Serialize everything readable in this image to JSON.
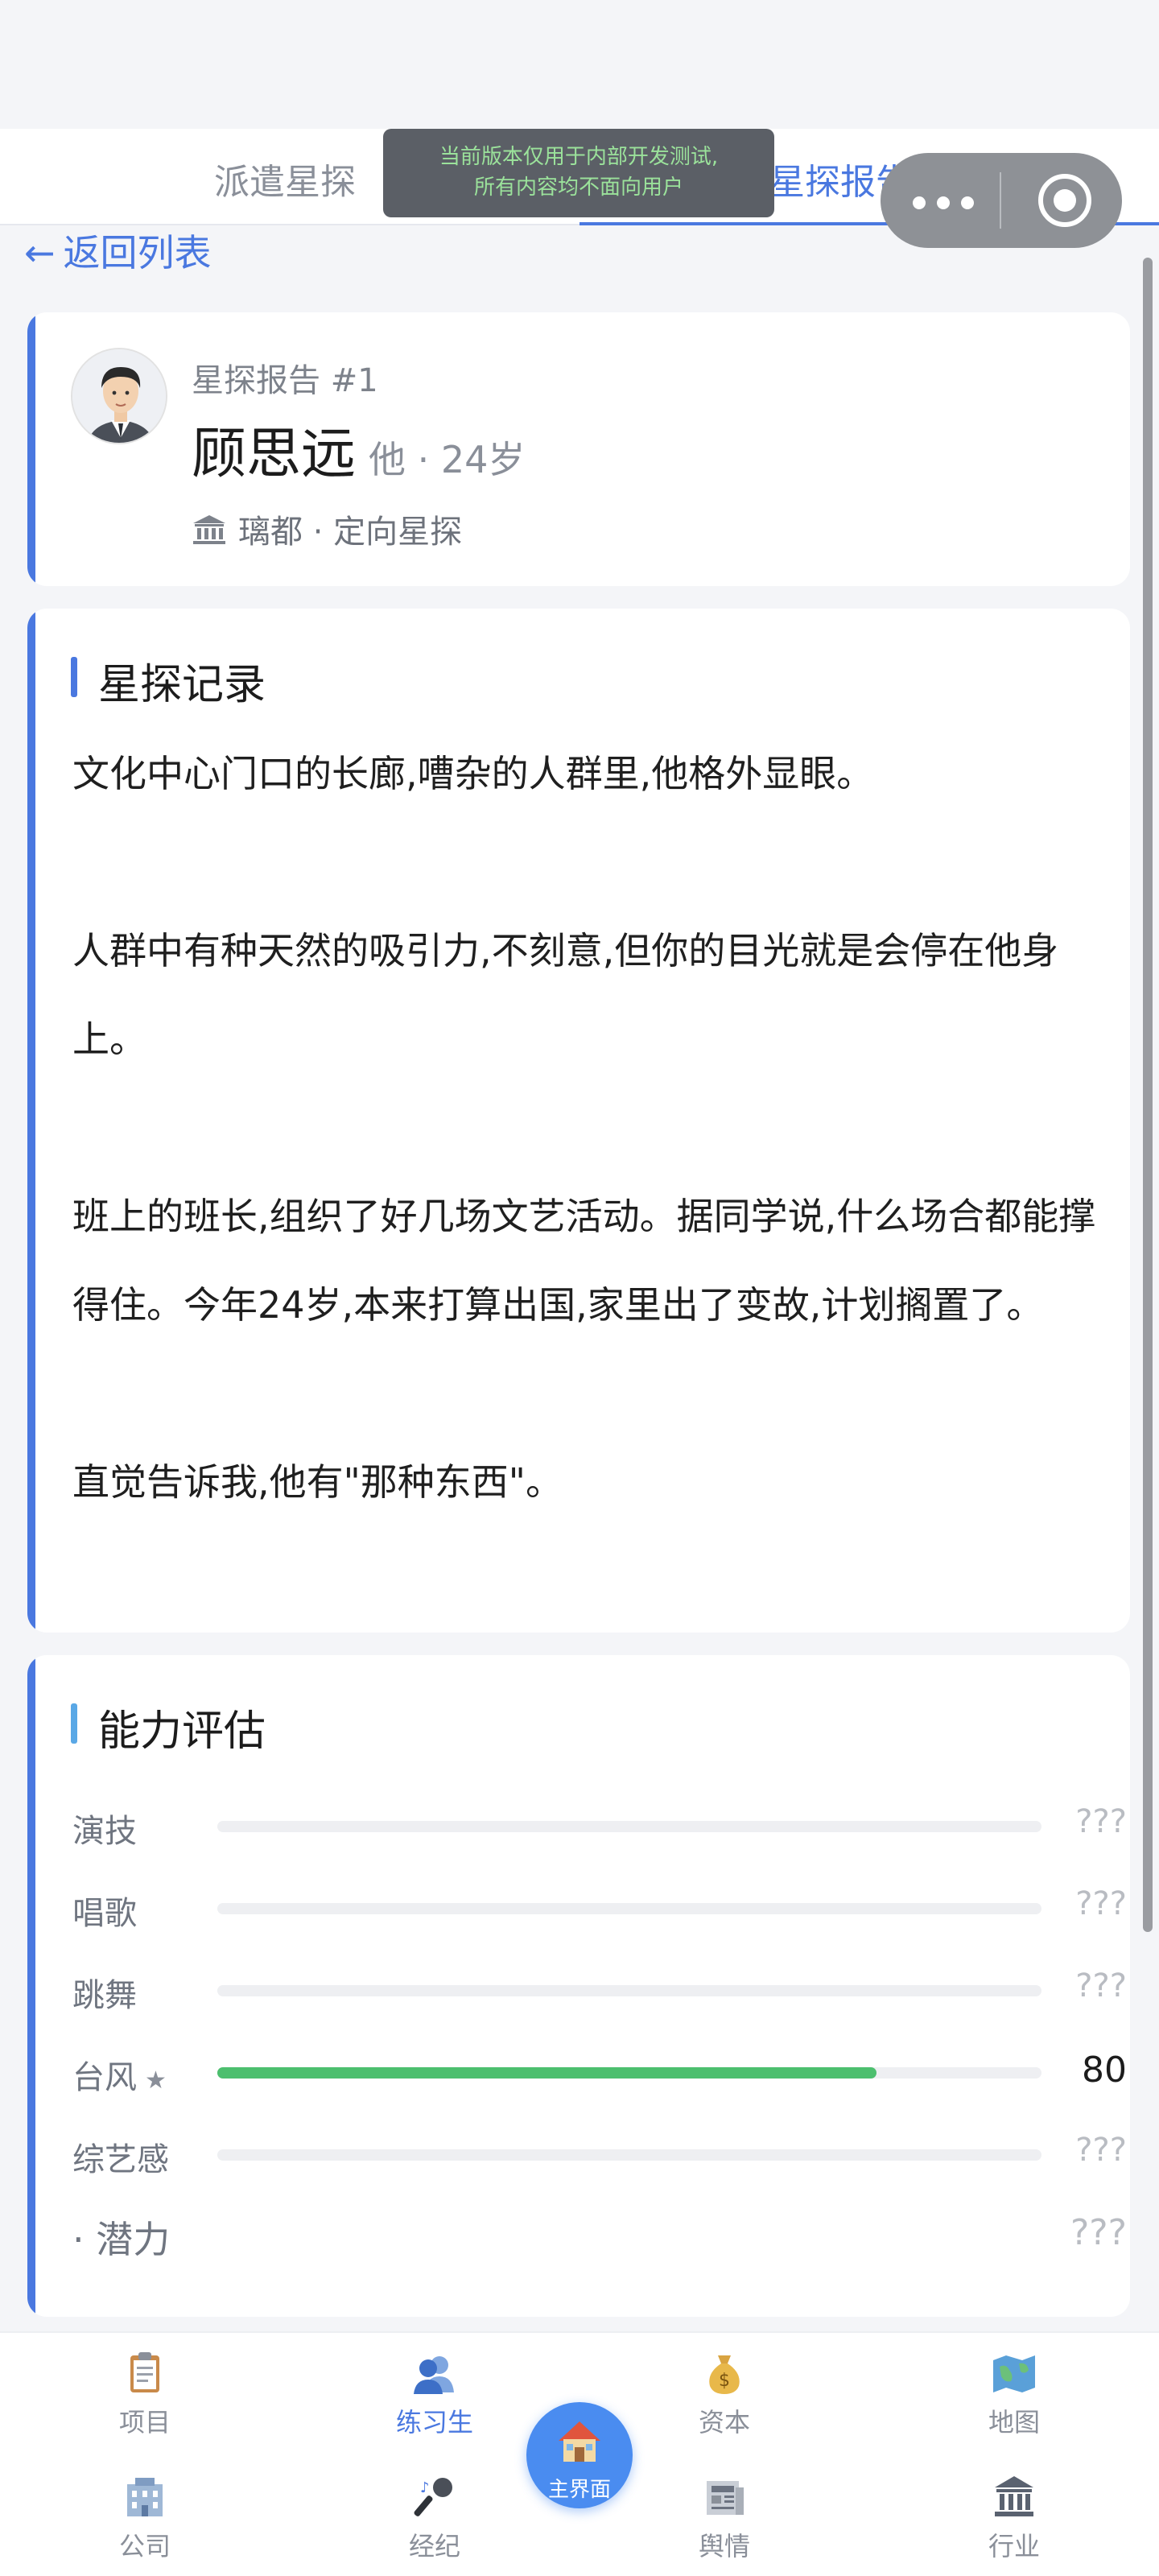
{
  "tabs": {
    "left_label": "派遣星探",
    "right_label": "星探报告 (1)"
  },
  "dev_banner": {
    "line1": "当前版本仅用于内部开发测试,",
    "line2": "所有内容均不面向用户"
  },
  "back": {
    "arrow": "←",
    "label": "返回列表"
  },
  "profile": {
    "report_number": "星探报告 #1",
    "name": "顾思远",
    "meta": "他 · 24岁",
    "origin": "璃都 · 定向星探"
  },
  "record": {
    "title": "星探记录",
    "paragraphs": [
      "文化中心门口的长廊,嘈杂的人群里,他格外显眼。",
      "人群中有种天然的吸引力,不刻意,但你的目光就是会停在他身上。",
      "班上的班长,组织了好几场文艺活动。据同学说,什么场合都能撑得住。今年24岁,本来打算出国,家里出了变故,计划搁置了。",
      "直觉告诉我,他有\"那种东西\"。"
    ]
  },
  "ability": {
    "title": "能力评估",
    "rows": [
      {
        "label": "演技",
        "value": "???",
        "fill": 0
      },
      {
        "label": "唱歌",
        "value": "???",
        "fill": 0
      },
      {
        "label": "跳舞",
        "value": "???",
        "fill": 0
      },
      {
        "label": "台风",
        "value": "80",
        "fill": 0.8,
        "starred": true
      },
      {
        "label": "综艺感",
        "value": "???",
        "fill": 0
      }
    ],
    "potential_label": "· 潜力",
    "potential_value": "???"
  },
  "colors": {
    "accent": "#4a78e0",
    "progress_fill": "#4cbf6e",
    "home_button": "#4a8cf0"
  },
  "nav": {
    "items": [
      {
        "label": "项目",
        "icon": "clipboard-icon"
      },
      {
        "label": "练习生",
        "icon": "trainee-icon",
        "active": true
      },
      {
        "label": "资本",
        "icon": "money-bag-icon"
      },
      {
        "label": "地图",
        "icon": "map-icon"
      },
      {
        "label": "公司",
        "icon": "office-building-icon"
      },
      {
        "label": "经纪",
        "icon": "microphone-icon"
      },
      {
        "label": "舆情",
        "icon": "newspaper-icon"
      },
      {
        "label": "行业",
        "icon": "bank-icon"
      }
    ],
    "home_label": "主界面"
  }
}
